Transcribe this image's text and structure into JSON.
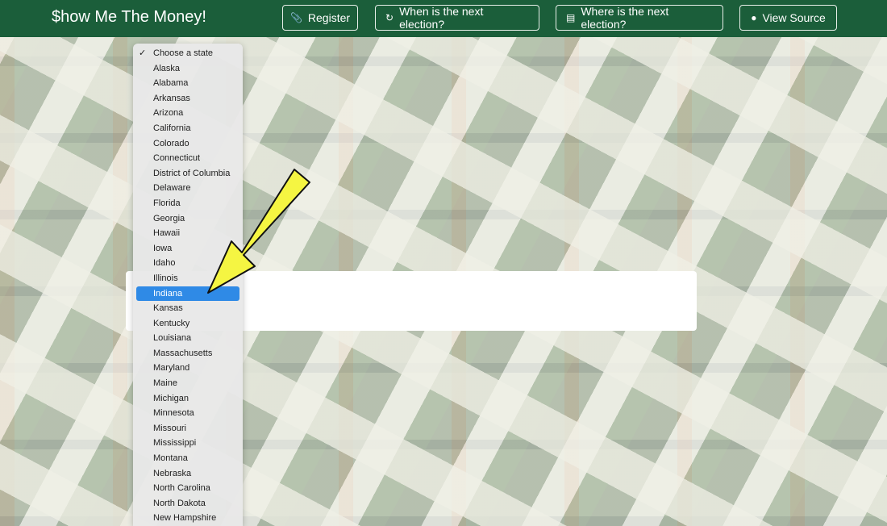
{
  "navbar": {
    "brand": "$how Me The Money!",
    "buttons": [
      {
        "label": "Register",
        "icon": "paperclip-icon"
      },
      {
        "label": "When is the next election?",
        "icon": "refresh-icon"
      },
      {
        "label": "Where is the next election?",
        "icon": "book-icon"
      },
      {
        "label": "View Source",
        "icon": "github-icon"
      }
    ]
  },
  "state_select": {
    "selected": "Choose a state",
    "highlighted": "Indiana",
    "options": [
      "Choose a state",
      "Alaska",
      "Alabama",
      "Arkansas",
      "Arizona",
      "California",
      "Colorado",
      "Connecticut",
      "District of Columbia",
      "Delaware",
      "Florida",
      "Georgia",
      "Hawaii",
      "Iowa",
      "Idaho",
      "Illinois",
      "Indiana",
      "Kansas",
      "Kentucky",
      "Louisiana",
      "Massachusetts",
      "Maryland",
      "Maine",
      "Michigan",
      "Minnesota",
      "Missouri",
      "Mississippi",
      "Montana",
      "Nebraska",
      "North Carolina",
      "North Dakota",
      "New Hampshire"
    ]
  },
  "colors": {
    "navbar": "#1b5e3a",
    "highlight": "#2f8ae6",
    "arrow": "#f5f542"
  }
}
